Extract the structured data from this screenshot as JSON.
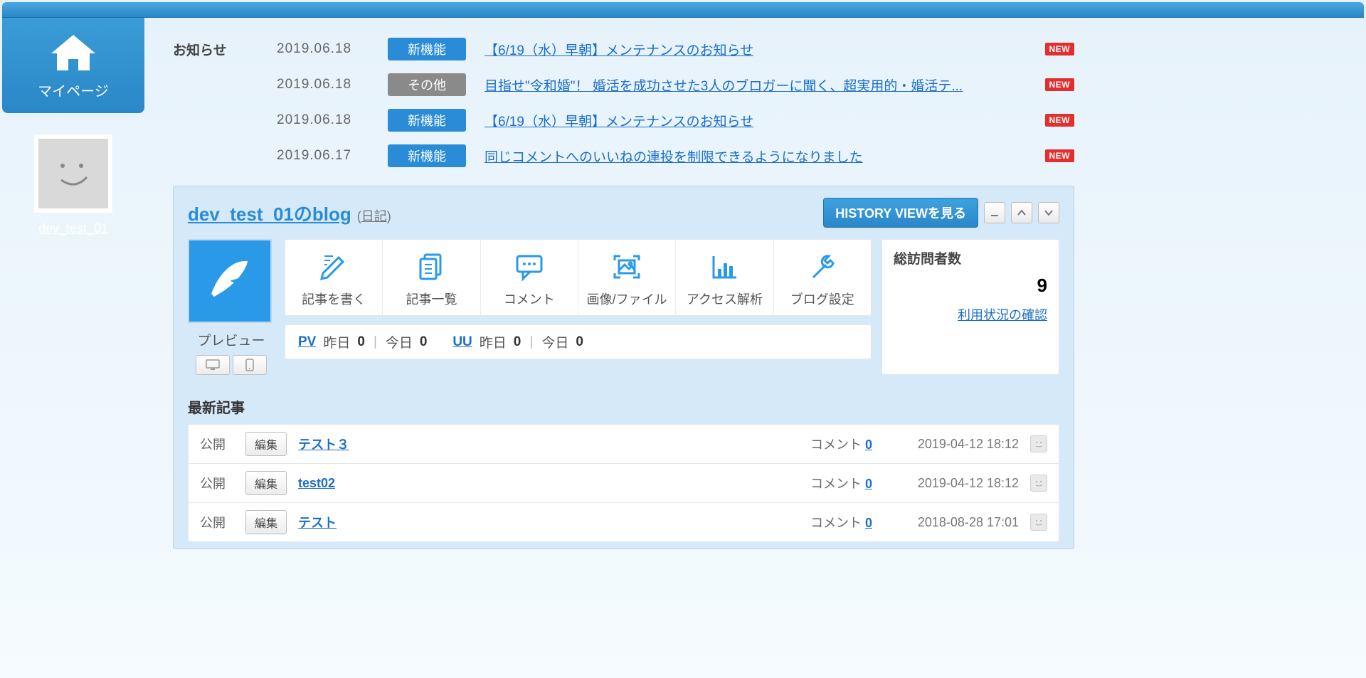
{
  "sidebar": {
    "home_label": "マイページ",
    "username": "dev_test_01"
  },
  "announcements": {
    "heading": "お知らせ",
    "items": [
      {
        "date": "2019.06.18",
        "badge": "新機能",
        "badge_type": "blue",
        "title": "【6/19（水）早朝】メンテナンスのお知らせ",
        "new": "NEW"
      },
      {
        "date": "2019.06.18",
        "badge": "その他",
        "badge_type": "gray",
        "title": "目指せ\"令和婚\"！ 婚活を成功させた3人のブロガーに聞く、超実用的・婚活テ...",
        "new": "NEW"
      },
      {
        "date": "2019.06.18",
        "badge": "新機能",
        "badge_type": "blue",
        "title": "【6/19（水）早朝】メンテナンスのお知らせ",
        "new": "NEW"
      },
      {
        "date": "2019.06.17",
        "badge": "新機能",
        "badge_type": "blue",
        "title": "同じコメントへのいいねの連投を制限できるようになりました",
        "new": "NEW"
      }
    ]
  },
  "blog": {
    "title": "dev_test_01のblog",
    "subtitle": "(日記)",
    "history_btn": "HISTORY VIEWを見る",
    "preview_label": "プレビュー",
    "actions": {
      "write": "記事を書く",
      "list": "記事一覧",
      "comment": "コメント",
      "media": "画像/ファイル",
      "analytics": "アクセス解析",
      "settings": "ブログ設定"
    },
    "stats": {
      "pv_label": "PV",
      "uu_label": "UU",
      "yesterday_label": "昨日",
      "today_label": "今日",
      "pv_yesterday": "0",
      "pv_today": "0",
      "uu_yesterday": "0",
      "uu_today": "0"
    },
    "visitors": {
      "title": "総訪問者数",
      "count": "9",
      "link": "利用状況の確認"
    }
  },
  "latest": {
    "title": "最新記事",
    "status_label": "公開",
    "edit_label": "編集",
    "comment_label": "コメント",
    "items": [
      {
        "title": "テスト３",
        "comments": "0",
        "date": "2019-04-12 18:12"
      },
      {
        "title": "test02",
        "comments": "0",
        "date": "2019-04-12 18:12"
      },
      {
        "title": "テスト",
        "comments": "0",
        "date": "2018-08-28 17:01"
      }
    ]
  }
}
